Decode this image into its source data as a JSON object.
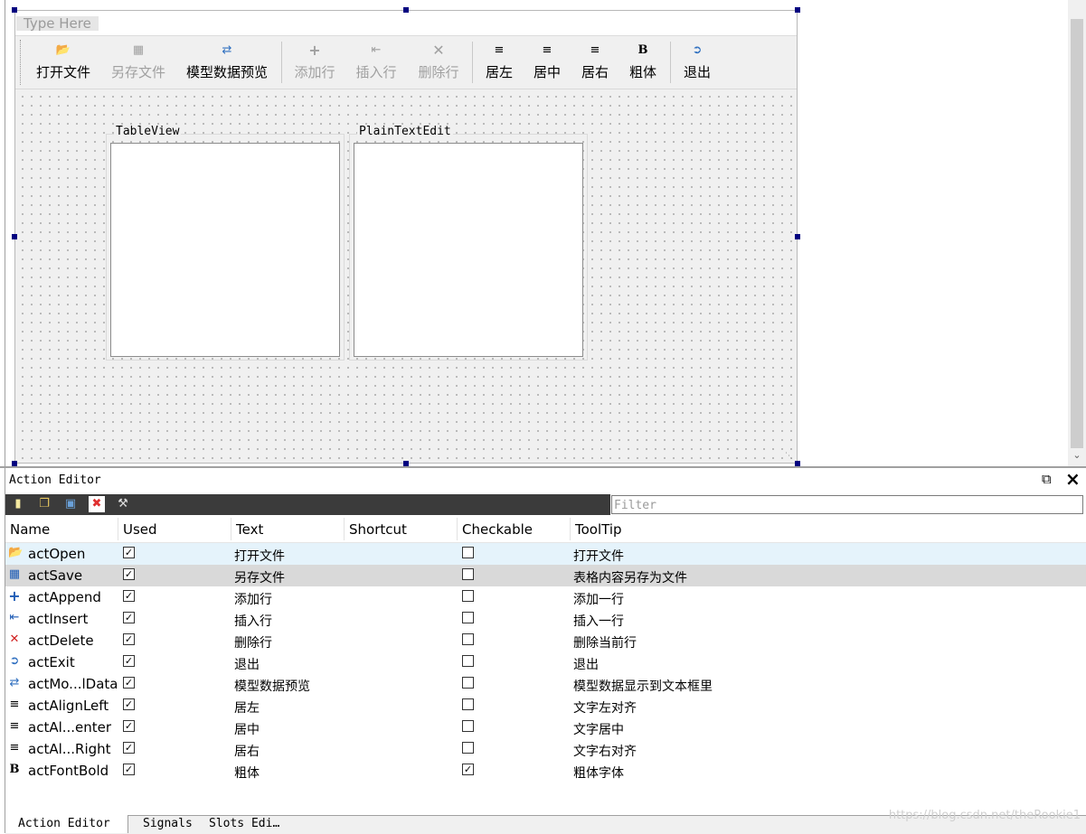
{
  "menubar": {
    "placeholder": "Type Here"
  },
  "toolbar": {
    "buttons": [
      {
        "label": "打开文件",
        "icon": "folder-open-icon",
        "enabled": true
      },
      {
        "label": "另存文件",
        "icon": "save-icon",
        "enabled": false
      },
      {
        "label": "模型数据预览",
        "icon": "preview-icon",
        "enabled": true
      },
      {
        "label": "添加行",
        "icon": "plus-icon",
        "enabled": false
      },
      {
        "label": "插入行",
        "icon": "insert-row-icon",
        "enabled": false
      },
      {
        "label": "删除行",
        "icon": "delete-icon",
        "enabled": false
      },
      {
        "label": "居左",
        "icon": "align-left-icon",
        "enabled": true
      },
      {
        "label": "居中",
        "icon": "align-center-icon",
        "enabled": true
      },
      {
        "label": "居右",
        "icon": "align-right-icon",
        "enabled": true
      },
      {
        "label": "粗体",
        "icon": "bold-icon",
        "enabled": true
      },
      {
        "label": "退出",
        "icon": "exit-icon",
        "enabled": true
      }
    ]
  },
  "canvas": {
    "groups": [
      {
        "title": "TableView"
      },
      {
        "title": "PlainTextEdit"
      }
    ]
  },
  "action_editor": {
    "title": "Action Editor",
    "filter_placeholder": "Filter",
    "columns": [
      "Name",
      "Used",
      "Text",
      "Shortcut",
      "Checkable",
      "ToolTip"
    ],
    "rows": [
      {
        "name": "actOpen",
        "icon": "folder-open-icon",
        "used": true,
        "text": "打开文件",
        "shortcut": "",
        "checkable": false,
        "tooltip": "打开文件"
      },
      {
        "name": "actSave",
        "icon": "save-icon",
        "used": true,
        "text": "另存文件",
        "shortcut": "",
        "checkable": false,
        "tooltip": "表格内容另存为文件"
      },
      {
        "name": "actAppend",
        "icon": "plus-icon",
        "used": true,
        "text": "添加行",
        "shortcut": "",
        "checkable": false,
        "tooltip": "添加一行"
      },
      {
        "name": "actInsert",
        "icon": "insert-row-icon",
        "used": true,
        "text": "插入行",
        "shortcut": "",
        "checkable": false,
        "tooltip": "插入一行"
      },
      {
        "name": "actDelete",
        "icon": "delete-icon",
        "used": true,
        "text": "删除行",
        "shortcut": "",
        "checkable": false,
        "tooltip": "删除当前行"
      },
      {
        "name": "actExit",
        "icon": "exit-icon",
        "used": true,
        "text": "退出",
        "shortcut": "",
        "checkable": false,
        "tooltip": "退出"
      },
      {
        "name": "actMo...lData",
        "icon": "preview-icon",
        "used": true,
        "text": "模型数据预览",
        "shortcut": "",
        "checkable": false,
        "tooltip": "模型数据显示到文本框里"
      },
      {
        "name": "actAlignLeft",
        "icon": "align-left-icon",
        "used": true,
        "text": "居左",
        "shortcut": "",
        "checkable": false,
        "tooltip": "文字左对齐"
      },
      {
        "name": "actAl...enter",
        "icon": "align-center-icon",
        "used": true,
        "text": "居中",
        "shortcut": "",
        "checkable": false,
        "tooltip": "文字居中"
      },
      {
        "name": "actAl...Right",
        "icon": "align-right-icon",
        "used": true,
        "text": "居右",
        "shortcut": "",
        "checkable": false,
        "tooltip": "文字右对齐"
      },
      {
        "name": "actFontBold",
        "icon": "bold-icon",
        "used": true,
        "text": "粗体",
        "shortcut": "",
        "checkable": true,
        "tooltip": "粗体字体"
      }
    ]
  },
  "bottom_tabs": [
    "Action Editor",
    "Signals",
    "Slots Edi…"
  ],
  "watermark": "https://blog.csdn.net/theRookie1",
  "colors": {
    "selection_handle": "#000080",
    "row_hover": "#e5f3fb",
    "row_selected": "#d9d9d9",
    "ae_toolbar": "#3b3b3b"
  }
}
